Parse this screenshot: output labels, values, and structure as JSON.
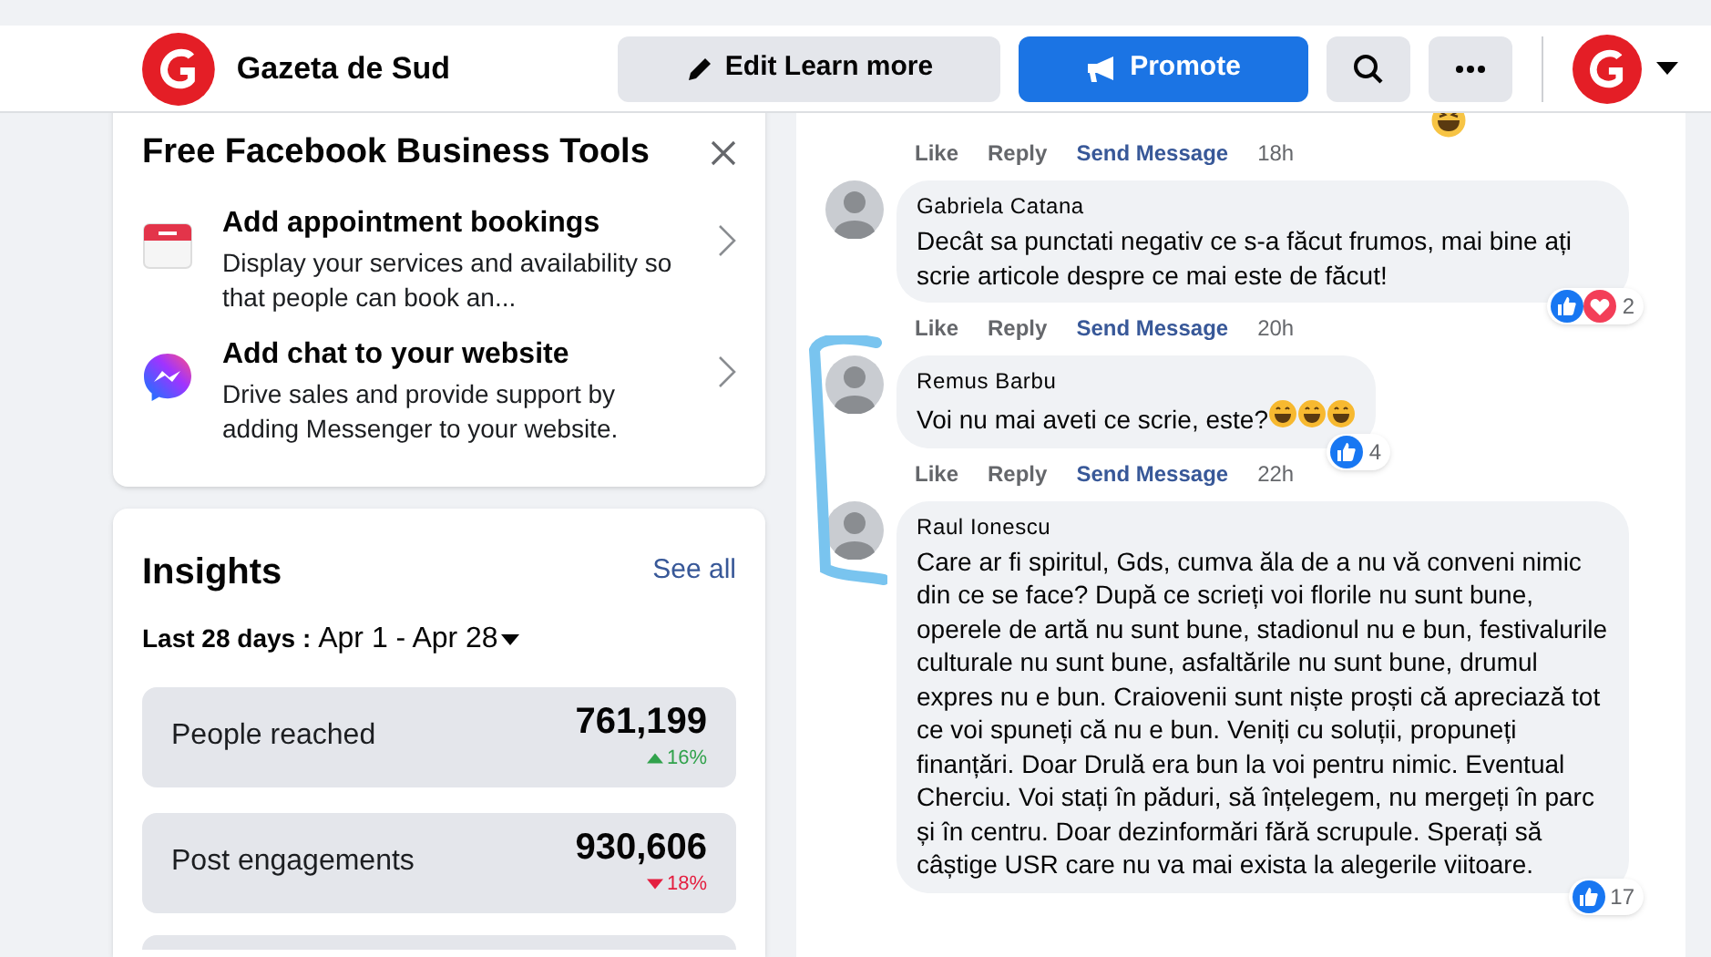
{
  "page": {
    "name": "Gazeta de Sud"
  },
  "header_buttons": [
    {
      "kind": "edit",
      "label": "Edit Learn more"
    },
    {
      "kind": "promote",
      "label": "Promote"
    },
    {
      "kind": "search"
    },
    {
      "kind": "more"
    }
  ],
  "business_tools": {
    "title": "Free Facebook Business Tools",
    "items": [
      {
        "kind": "calendar",
        "title": "Add appointment bookings",
        "description": "Display your services and availability so that people can book an..."
      },
      {
        "kind": "messenger",
        "title": "Add chat to your website",
        "description": "Drive sales and provide support by adding Messenger to your website."
      }
    ]
  },
  "insights": {
    "title": "Insights",
    "see_all": "See all",
    "period_label": "Last 28 days :",
    "period": "Apr 1 - Apr 28",
    "metrics": [
      {
        "label": "People reached",
        "value": "761,199",
        "change": "16%",
        "rising": true
      },
      {
        "label": "Post engagements",
        "value": "930,606",
        "change": "18%",
        "rising": false
      }
    ]
  },
  "comments": [
    {
      "actions": [
        "Like",
        "Reply",
        "Send Message"
      ],
      "time": "18h",
      "reactions": {
        "haha": true
      }
    },
    {
      "author": "Gabriela Catana",
      "text": "Decât sa punctati negativ ce s-a făcut frumos, mai bine ați scrie articole despre ce mai este de făcut!",
      "actions": [
        "Like",
        "Reply",
        "Send Message"
      ],
      "time": "20h",
      "reactions": {
        "like": true,
        "love": true,
        "count": "2"
      }
    },
    {
      "author": "Remus Barbu",
      "text": "Voi nu mai aveti ce scrie, este?",
      "laughing_emojis": true,
      "actions": [
        "Like",
        "Reply",
        "Send Message"
      ],
      "time": "22h",
      "reactions": {
        "like": true,
        "count": "4"
      }
    },
    {
      "author": "Raul Ionescu",
      "text": "Care ar fi spiritul, Gds, cumva ăla de a nu vă conveni nimic din ce se face? După ce scrieți voi florile nu sunt bune, operele de artă nu sunt bune, stadionul nu e bun, festivalurile culturale nu sunt bune, asfaltările nu sunt bune, drumul expres nu e bun. Craiovenii sunt niște proști că apreciază tot ce voi spuneți că nu e bun. Veniți cu soluții, propuneți finanțări. Doar Drulă era bun la voi pentru nimic. Eventual Cherciu. Voi stați în păduri, să înțelegem, nu mergeți în parc și în centru. Doar dezinformări fără scrupule. Sperați să câștige USR care nu va mai exista la alegerile viitoare.",
      "reactions": {
        "like": true,
        "count": "17"
      }
    }
  ]
}
